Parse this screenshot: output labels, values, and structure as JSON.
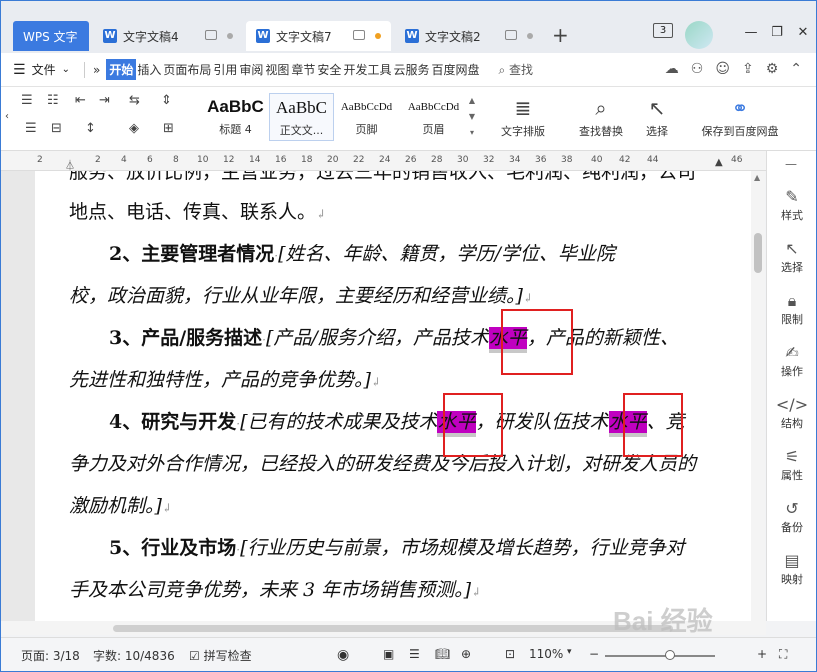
{
  "tabs": {
    "app_label": "WPS 文字",
    "doc4_label": "文字文稿4",
    "doc7_label": "文字文稿7",
    "doc2_label": "文字文稿2",
    "add_label": "+"
  },
  "window": {
    "badge": "3",
    "min": "—",
    "restore": "❐",
    "close": "✕"
  },
  "menu": {
    "file_label": "文件",
    "items": [
      "开始",
      "插入",
      "页面布局",
      "引用",
      "审阅",
      "视图",
      "章节",
      "安全",
      "开发工具",
      "云服务",
      "百度网盘"
    ],
    "search_label": "查找"
  },
  "ribbon": {
    "styles": [
      {
        "sample": "AaBbC",
        "label": "标题 4"
      },
      {
        "sample": "AaBbC",
        "label": "正文文..."
      },
      {
        "sample": "AaBbCcDd",
        "label": "页脚"
      },
      {
        "sample": "AaBbCcDd",
        "label": "页眉"
      }
    ],
    "text_layout": "文字排版",
    "find_replace": "查找替换",
    "select": "选择",
    "save_baidu": "保存到百度网盘"
  },
  "ruler": {
    "ticks": [
      "2",
      "2",
      "4",
      "6",
      "8",
      "10",
      "12",
      "14",
      "16",
      "18",
      "20",
      "22",
      "24",
      "26",
      "28",
      "30",
      "32",
      "34",
      "36",
      "38",
      "40",
      "42",
      "44",
      "46"
    ]
  },
  "document": {
    "line0": "服务、放价比例，主营业务，过去三年的销售收入、毛利润、纯利润，公司",
    "line1": "地点、电话、传真、联系人。",
    "p2_head": "2、主要管理者情况",
    "p2_body": "[姓名、年龄、籍贯，学历/学位、毕业院",
    "p2_line2": "校，政治面貌，行业从业年限，主要经历和经营业绩。]",
    "p3_head": "3、产品/服务描述",
    "p3_pre": "[产品/服务介绍，产品技术",
    "p3_hl": "水平",
    "p3_post": "，产品的新颖性、",
    "p3_line2": "先进性和独特性，产品的竞争优势。]",
    "p4_head": "4、研究与开发",
    "p4_pre": "[已有的技术成果及技术",
    "p4_hl1": "水平",
    "p4_mid": "，研发队伍技术",
    "p4_hl2": "水平",
    "p4_post": "、竞",
    "p4_line2": "争力及对外合作情况，已经投入的研发经费及今后投入计划，对研发人员的",
    "p4_line3": "激励机制。]",
    "p5_head": "5、行业及市场",
    "p5_body": "[行业历史与前景，市场规模及增长趋势，行业竞争对",
    "p5_line2": "手及本公司竞争优势，未来 3 年市场销售预测。]"
  },
  "sidebar": [
    "样式",
    "选择",
    "限制",
    "操作",
    "结构",
    "属性",
    "备份",
    "映射"
  ],
  "status": {
    "page": "页面: 3/18",
    "words": "字数: 10/4836",
    "spell": "拼写检查",
    "zoom": "110%"
  },
  "watermark": "Bai 经验"
}
